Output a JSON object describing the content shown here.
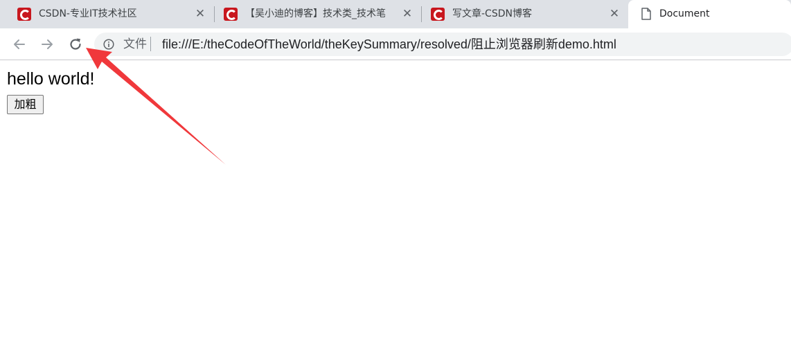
{
  "browser": {
    "tabs": [
      {
        "title": "CSDN-专业IT技术社区",
        "close": "✕",
        "icon": "csdn-icon"
      },
      {
        "title": "【吴小迪的博客】技术类_技术笔",
        "close": "✕",
        "icon": "csdn-icon"
      },
      {
        "title": "写文章-CSDN博客",
        "close": "✕",
        "icon": "csdn-icon"
      },
      {
        "title": "Document",
        "icon": "document-icon",
        "active": true
      }
    ],
    "toolbar": {
      "back": "back-arrow-icon",
      "forward": "forward-arrow-icon",
      "reload": "reload-icon"
    },
    "omnibox": {
      "info_icon": "info-icon",
      "scheme_label": "文件",
      "url": "file:///E:/theCodeOfTheWorld/theKeySummary/resolved/阻止浏览器刷新demo.html"
    }
  },
  "page": {
    "heading": "hello world!",
    "button_label": "加粗"
  },
  "colors": {
    "tabstrip_bg": "#dee1e6",
    "csdn_red": "#c8171e",
    "annotation_arrow": "#f0383b",
    "omnibox_bg": "#f1f3f4"
  }
}
